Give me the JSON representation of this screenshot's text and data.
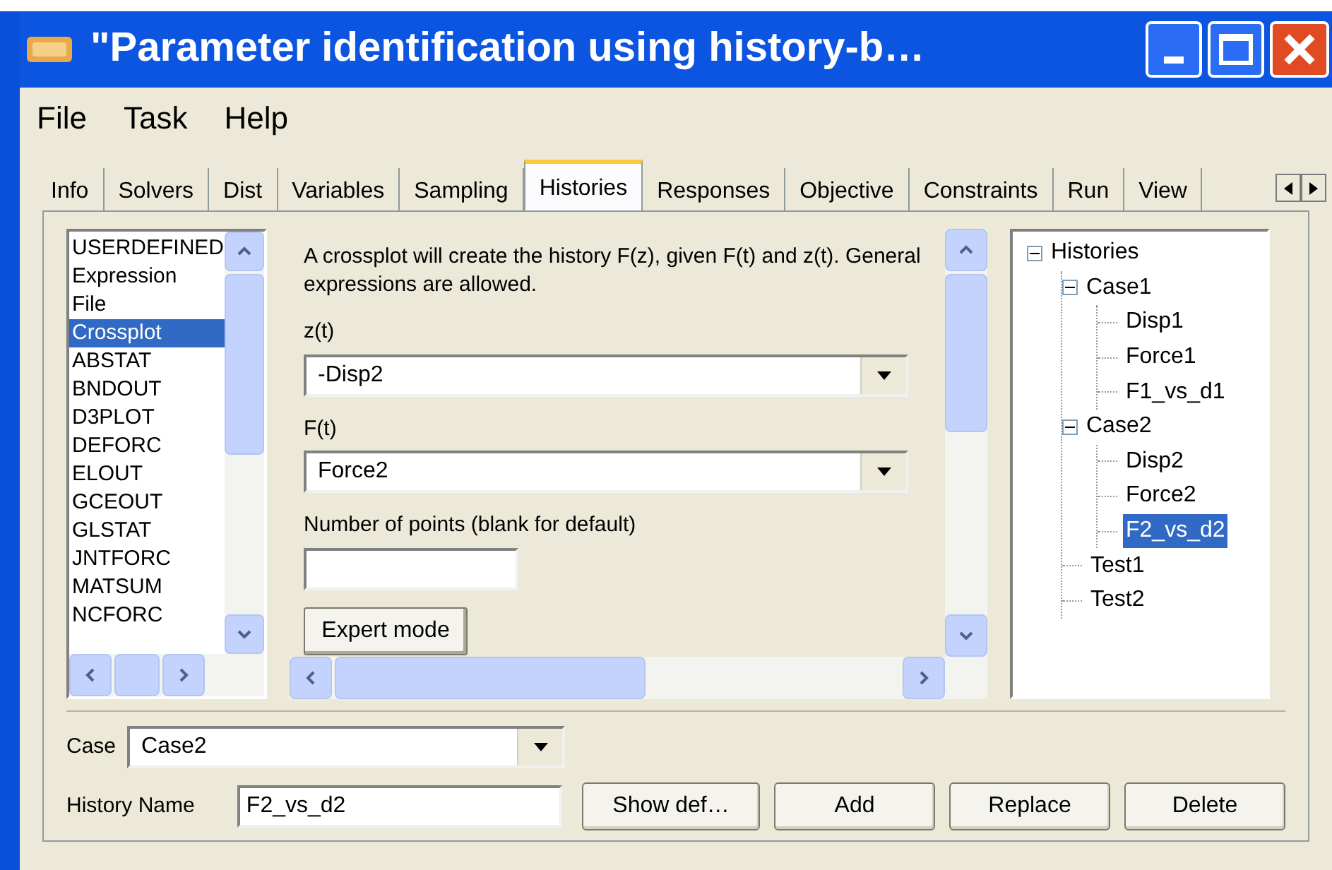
{
  "window": {
    "title": "\"Parameter identification using history-b…"
  },
  "menu": [
    "File",
    "Task",
    "Help"
  ],
  "tabs": [
    {
      "label": "Info",
      "selected": false
    },
    {
      "label": "Solvers",
      "selected": false
    },
    {
      "label": "Dist",
      "selected": false
    },
    {
      "label": "Variables",
      "selected": false
    },
    {
      "label": "Sampling",
      "selected": false
    },
    {
      "label": "Histories",
      "selected": true
    },
    {
      "label": "Responses",
      "selected": false
    },
    {
      "label": "Objective",
      "selected": false
    },
    {
      "label": "Constraints",
      "selected": false
    },
    {
      "label": "Run",
      "selected": false
    },
    {
      "label": "View",
      "selected": false
    }
  ],
  "history_types": [
    {
      "label": "USERDEFINED",
      "selected": false
    },
    {
      "label": "Expression",
      "selected": false
    },
    {
      "label": "File",
      "selected": false
    },
    {
      "label": "Crossplot",
      "selected": true
    },
    {
      "label": "ABSTAT",
      "selected": false
    },
    {
      "label": "BNDOUT",
      "selected": false
    },
    {
      "label": "D3PLOT",
      "selected": false
    },
    {
      "label": "DEFORC",
      "selected": false
    },
    {
      "label": "ELOUT",
      "selected": false
    },
    {
      "label": "GCEOUT",
      "selected": false
    },
    {
      "label": "GLSTAT",
      "selected": false
    },
    {
      "label": "JNTFORC",
      "selected": false
    },
    {
      "label": "MATSUM",
      "selected": false
    },
    {
      "label": "NCFORC",
      "selected": false
    }
  ],
  "description": "A crossplot will create the history F(z), given F(t) and z(t). General expressions are allowed.",
  "z_field": {
    "label": "z(t)",
    "value": "-Disp2"
  },
  "f_field": {
    "label": "F(t)",
    "value": "Force2"
  },
  "points_field": {
    "label": "Number of points (blank for default)"
  },
  "expert_button": "Expert mode",
  "tree": [
    {
      "label": "Histories",
      "expanded": true,
      "selected": false,
      "children": [
        {
          "label": "Case1",
          "expanded": true,
          "selected": false,
          "children": [
            {
              "label": "Disp1",
              "selected": false
            },
            {
              "label": "Force1",
              "selected": false
            },
            {
              "label": "F1_vs_d1",
              "selected": false
            }
          ]
        },
        {
          "label": "Case2",
          "expanded": true,
          "selected": false,
          "children": [
            {
              "label": "Disp2",
              "selected": false
            },
            {
              "label": "Force2",
              "selected": false
            },
            {
              "label": "F2_vs_d2",
              "selected": true
            }
          ]
        },
        {
          "label": "Test1",
          "selected": false
        },
        {
          "label": "Test2",
          "selected": false
        }
      ]
    }
  ],
  "case_field": {
    "label": "Case",
    "value": "Case2"
  },
  "history_name_field": {
    "label": "History Name",
    "value": "F2_vs_d2"
  },
  "buttons": [
    "Show def…",
    "Add",
    "Replace",
    "Delete"
  ]
}
